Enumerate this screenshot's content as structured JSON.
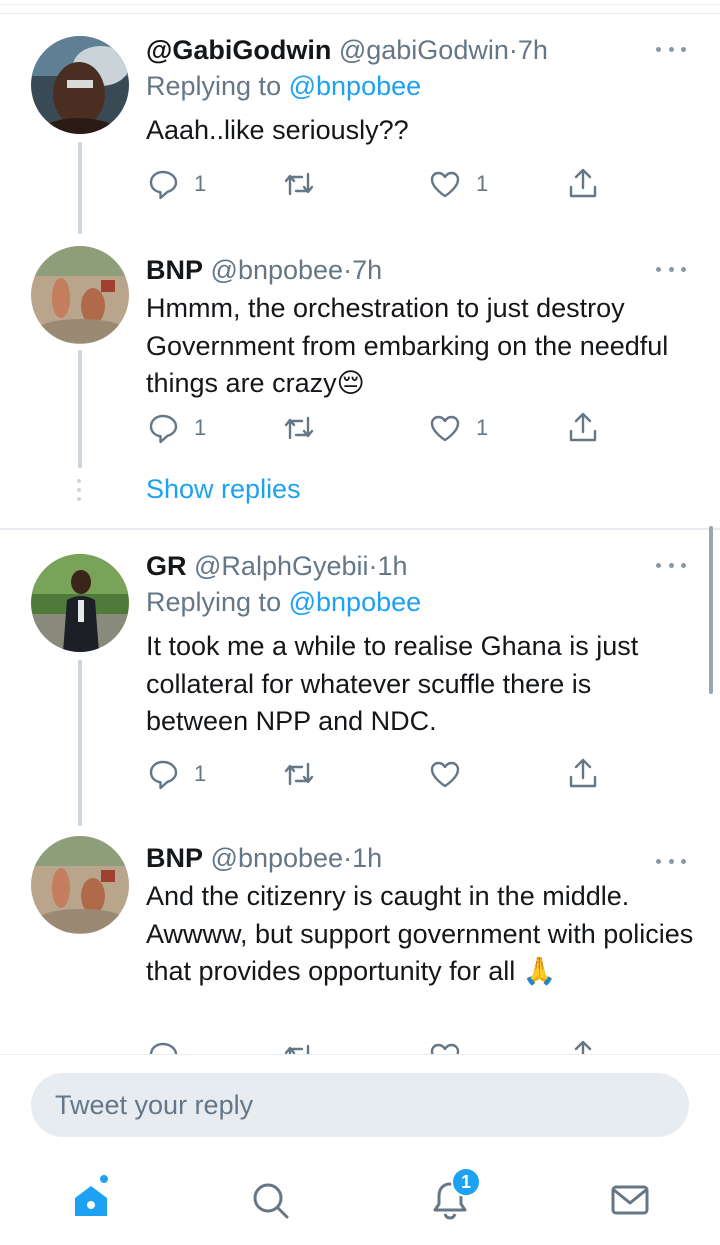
{
  "tweets": [
    {
      "display_name": "@GabiGodwin",
      "handle": "@gabiGodwin",
      "separator": "·",
      "time": "7h",
      "replying_prefix": "Replying to",
      "replying_to": "@bnpobee",
      "text": "Aaah..like seriously??",
      "reply_count": "1",
      "retweet_count": "",
      "like_count": "1"
    },
    {
      "display_name": "BNP",
      "handle": "@bnpobee",
      "separator": "·",
      "time": "7h",
      "text": "Hmmm, the orchestration to just destroy Government from embarking on the needful things are crazy😔",
      "reply_count": "1",
      "retweet_count": "",
      "like_count": "1"
    },
    {
      "display_name": "GR",
      "handle": "@RalphGyebii",
      "separator": "·",
      "time": "1h",
      "replying_prefix": "Replying to",
      "replying_to": "@bnpobee",
      "text": "It took me a while to realise Ghana is just collateral for whatever scuffle there is between NPP and NDC.",
      "reply_count": "1",
      "retweet_count": "",
      "like_count": ""
    },
    {
      "display_name": "BNP",
      "handle": "@bnpobee",
      "separator": "·",
      "time": "1h",
      "text": "And the citizenry is caught in the middle. Awwww, but support government with policies that provides opportunity for all 🙏",
      "reply_count": "",
      "retweet_count": "",
      "like_count": ""
    }
  ],
  "show_replies_label": "Show replies",
  "compose": {
    "placeholder": "Tweet your reply"
  },
  "tabbar": {
    "items": [
      "home",
      "search",
      "notifications",
      "messages"
    ],
    "notifications_badge": "1"
  },
  "colors": {
    "accent": "#1da1f2",
    "muted": "#657786",
    "text": "#14171a",
    "divider": "#e6ecf0"
  },
  "icons": [
    "reply-icon",
    "retweet-icon",
    "like-icon",
    "share-icon",
    "more-icon",
    "home-icon",
    "search-icon",
    "bell-icon",
    "mail-icon"
  ]
}
